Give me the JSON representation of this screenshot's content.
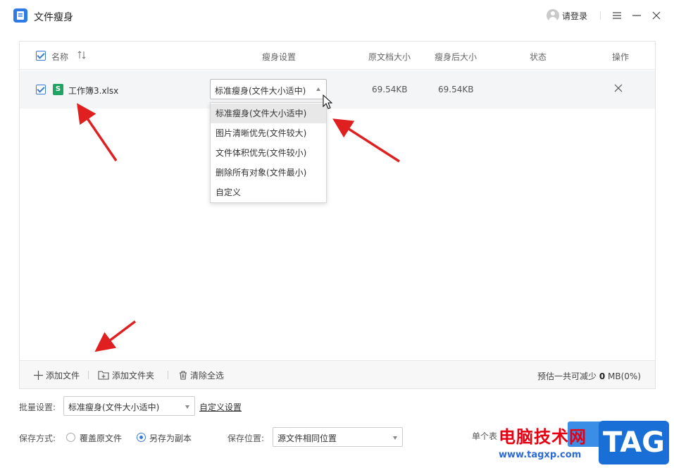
{
  "app": {
    "title": "文件瘦身",
    "login": "请登录"
  },
  "table": {
    "headers": {
      "name": "名称",
      "setting": "瘦身设置",
      "orig_size": "原文档大小",
      "new_size": "瘦身后大小",
      "status": "状态",
      "action": "操作"
    },
    "rows": [
      {
        "filename": "工作簿3.xlsx",
        "setting": "标准瘦身(文件大小适中)",
        "orig_size": "69.54KB",
        "new_size": "69.54KB",
        "status": ""
      }
    ]
  },
  "dropdown": {
    "options": [
      "标准瘦身(文件大小适中)",
      "图片清晰优先(文件较大)",
      "文件体积优先(文件较小)",
      "删除所有对象(文件最小)",
      "自定义"
    ],
    "selected_index": 0
  },
  "footer": {
    "add_file": "添加文件",
    "add_folder": "添加文件夹",
    "clear_all": "清除全选",
    "estimate_prefix": "预估一共可减少",
    "estimate_value": "0",
    "estimate_suffix": "MB(0%)"
  },
  "settings": {
    "batch_label": "批量设置:",
    "batch_value": "标准瘦身(文件大小适中)",
    "custom_link": "自定义设置",
    "save_mode_label": "保存方式:",
    "overwrite": "覆盖原文件",
    "save_copy": "另存为副本",
    "save_copy_selected": true,
    "save_location_label": "保存位置:",
    "save_location_value": "源文件相同位置",
    "single_label": "单个表"
  },
  "watermark": {
    "text": "电脑技术网",
    "url": "www.tagxp.com",
    "tag": "TAG"
  },
  "colors": {
    "accent": "#3a7bd5",
    "xlsx": "#1fa463",
    "arrow": "#e02020",
    "watermark_red": "#e60012",
    "watermark_blue": "#1a6fd6"
  }
}
